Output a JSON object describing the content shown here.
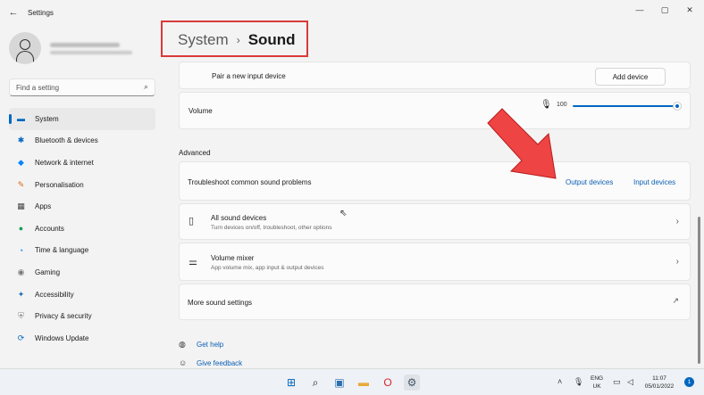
{
  "window": {
    "app_title": "Settings",
    "back_icon": "←",
    "min_icon": "—",
    "max_icon": "▢",
    "close_icon": "✕"
  },
  "sidebar": {
    "search_placeholder": "Find a setting",
    "items": [
      {
        "label": "System",
        "icon": "▬",
        "color": "#0067c0",
        "active": true
      },
      {
        "label": "Bluetooth & devices",
        "icon": "✱",
        "color": "#0067c0"
      },
      {
        "label": "Network & internet",
        "icon": "◆",
        "color": "#0a84ff"
      },
      {
        "label": "Personalisation",
        "icon": "✎",
        "color": "#d46a1a"
      },
      {
        "label": "Apps",
        "icon": "▦",
        "color": "#444"
      },
      {
        "label": "Accounts",
        "icon": "●",
        "color": "#1e9e5a"
      },
      {
        "label": "Time & language",
        "icon": "◔",
        "color": "#0a84ff"
      },
      {
        "label": "Gaming",
        "icon": "◉",
        "color": "#777"
      },
      {
        "label": "Accessibility",
        "icon": "✦",
        "color": "#1f6fb8"
      },
      {
        "label": "Privacy & security",
        "icon": "⛨",
        "color": "#888"
      },
      {
        "label": "Windows Update",
        "icon": "⟳",
        "color": "#0067c0"
      }
    ]
  },
  "breadcrumb": {
    "parent": "System",
    "separator": "›",
    "current": "Sound"
  },
  "main": {
    "pair_device_label": "Pair a new input device",
    "add_device_button": "Add device",
    "volume_label": "Volume",
    "volume_value": "100",
    "volume_level": 1.0,
    "advanced_title": "Advanced",
    "troubleshoot_label": "Troubleshoot common sound problems",
    "output_devices_link": "Output devices",
    "input_devices_link": "Input devices",
    "all_sound_devices_title": "All sound devices",
    "all_sound_devices_sub": "Turn devices on/off, troubleshoot, other options",
    "volume_mixer_title": "Volume mixer",
    "volume_mixer_sub": "App volume mix, app input & output devices",
    "more_sound_settings": "More sound settings",
    "get_help": "Get help",
    "give_feedback": "Give feedback"
  },
  "taskbar": {
    "lang_line1": "ENG",
    "lang_line2": "UK",
    "time": "11:07",
    "date": "05/01/2022",
    "notification_count": "1"
  },
  "colors": {
    "accent": "#0067c0",
    "link": "#0a5fb4",
    "highlight_red": "#d93a3a",
    "arrow_red": "#ef4444"
  }
}
